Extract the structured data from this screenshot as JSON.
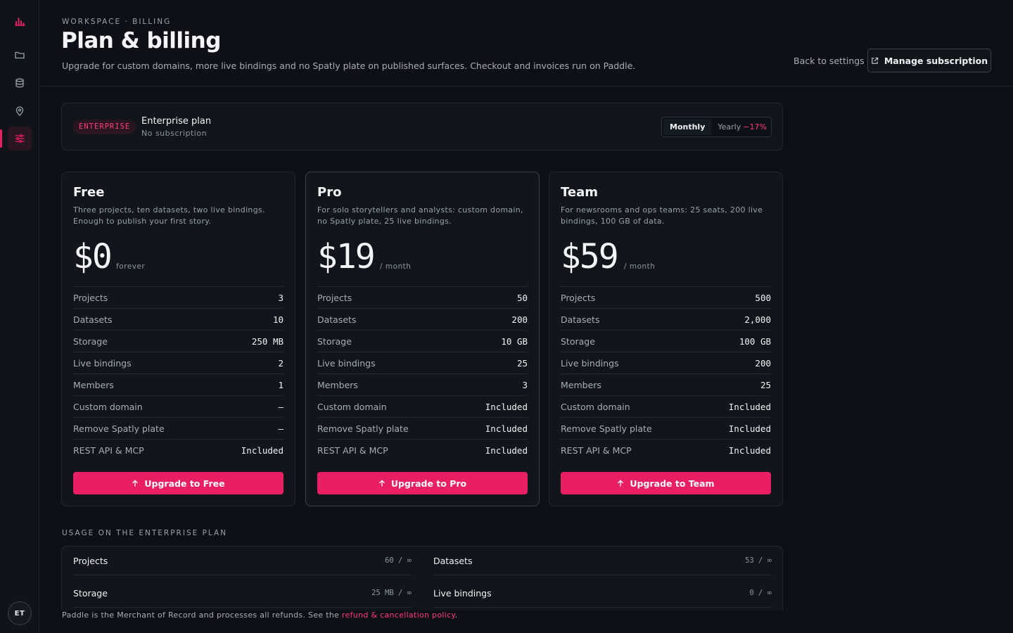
{
  "sidebar": {
    "icons": [
      "logo-icon",
      "folder-icon",
      "database-icon",
      "map-pin-icon",
      "sliders-icon"
    ],
    "avatar_initials": "ET",
    "accent": "#e91e63"
  },
  "header": {
    "eyebrow": "WORKSPACE · BILLING",
    "title": "Plan & billing",
    "subtitle": "Upgrade for custom domains, more live bindings and no Spatly plate on published surfaces. Checkout and invoices run on Paddle.",
    "back_link": "Back to settings",
    "manage_label": "Manage subscription"
  },
  "current_plan": {
    "badge": "ENTERPRISE",
    "name": "Enterprise plan",
    "status": "No subscription",
    "toggle": {
      "monthly": "Monthly",
      "yearly": "Yearly",
      "discount": "−17%",
      "selected": "Monthly"
    }
  },
  "tiers": [
    {
      "name": "Free",
      "description": "Three projects, ten datasets, two live bindings. Enough to publish your first story.",
      "price": "$0",
      "period": "forever",
      "features": [
        {
          "label": "Projects",
          "value": "3"
        },
        {
          "label": "Datasets",
          "value": "10"
        },
        {
          "label": "Storage",
          "value": "250 MB"
        },
        {
          "label": "Live bindings",
          "value": "2"
        },
        {
          "label": "Members",
          "value": "1"
        },
        {
          "label": "Custom domain",
          "value": "—"
        },
        {
          "label": "Remove Spatly plate",
          "value": "—"
        },
        {
          "label": "REST API & MCP",
          "value": "Included"
        }
      ],
      "cta": "Upgrade to Free"
    },
    {
      "name": "Pro",
      "description": "For solo storytellers and analysts: custom domain, no Spatly plate, 25 live bindings.",
      "price": "$19",
      "period": "/ month",
      "features": [
        {
          "label": "Projects",
          "value": "50"
        },
        {
          "label": "Datasets",
          "value": "200"
        },
        {
          "label": "Storage",
          "value": "10 GB"
        },
        {
          "label": "Live bindings",
          "value": "25"
        },
        {
          "label": "Members",
          "value": "3"
        },
        {
          "label": "Custom domain",
          "value": "Included"
        },
        {
          "label": "Remove Spatly plate",
          "value": "Included"
        },
        {
          "label": "REST API & MCP",
          "value": "Included"
        }
      ],
      "cta": "Upgrade to Pro"
    },
    {
      "name": "Team",
      "description": "For newsrooms and ops teams: 25 seats, 200 live bindings, 100 GB of data.",
      "price": "$59",
      "period": "/ month",
      "features": [
        {
          "label": "Projects",
          "value": "500"
        },
        {
          "label": "Datasets",
          "value": "2,000"
        },
        {
          "label": "Storage",
          "value": "100 GB"
        },
        {
          "label": "Live bindings",
          "value": "200"
        },
        {
          "label": "Members",
          "value": "25"
        },
        {
          "label": "Custom domain",
          "value": "Included"
        },
        {
          "label": "Remove Spatly plate",
          "value": "Included"
        },
        {
          "label": "REST API & MCP",
          "value": "Included"
        }
      ],
      "cta": "Upgrade to Team"
    }
  ],
  "usage": {
    "heading": "USAGE ON THE ENTERPRISE PLAN",
    "items": [
      {
        "label": "Projects",
        "value": "60 / ∞"
      },
      {
        "label": "Datasets",
        "value": "53 / ∞"
      },
      {
        "label": "Storage",
        "value": "25 MB / ∞"
      },
      {
        "label": "Live bindings",
        "value": "0 / ∞"
      }
    ]
  },
  "footer": {
    "text": "Paddle is the Merchant of Record and processes all refunds. See the ",
    "link": "refund & cancellation policy",
    "end": "."
  }
}
